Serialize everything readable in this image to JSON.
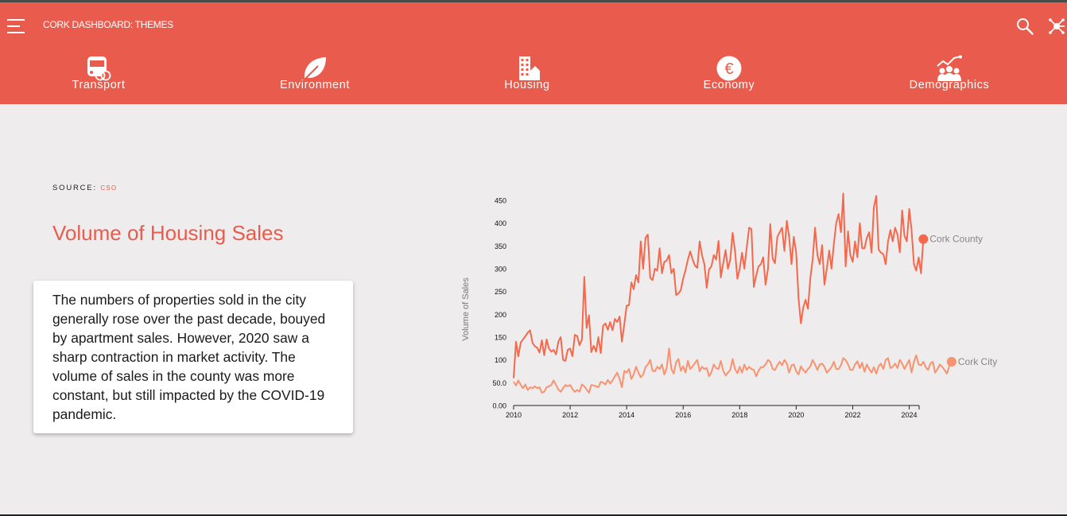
{
  "header": {
    "app_title": "CORK DASHBOARD: THEMES",
    "background": "#e95c4d",
    "nav": [
      {
        "label": "Transport",
        "icon": "bus-bike-icon"
      },
      {
        "label": "Environment",
        "icon": "leaf-icon"
      },
      {
        "label": "Housing",
        "icon": "building-icon"
      },
      {
        "label": "Economy",
        "icon": "euro-icon"
      },
      {
        "label": "Demographics",
        "icon": "people-chart-icon"
      }
    ]
  },
  "source": {
    "label": "SOURCE:",
    "link": "CSO"
  },
  "main": {
    "title": "Volume of Housing Sales",
    "description": "The numbers of properties sold in the city generally rose over the past decade, bouyed by apartment sales. However, 2020 saw a sharp contraction in market activity. The volume of sales in the county was more constant, but still impacted by the COVID-19 pandemic."
  },
  "chart_data": {
    "type": "line",
    "ylabel": "Volume of Sales",
    "xlabel": "",
    "xlim": [
      2010,
      2024.35
    ],
    "ylim": [
      0,
      450
    ],
    "x_ticks": [
      "2010",
      "2012",
      "2014",
      "2016",
      "2018",
      "2020",
      "2022",
      "2024"
    ],
    "y_ticks": [
      "0.00",
      "50.0",
      "100",
      "150",
      "200",
      "250",
      "300",
      "350",
      "400",
      "450"
    ],
    "grid": false,
    "x_step_months": 1,
    "x_start": 2010,
    "series": [
      {
        "name": "Cork County",
        "color": "#f4684c",
        "values": [
          60,
          140,
          108,
          138,
          145,
          152,
          160,
          165,
          138,
          130,
          127,
          116,
          143,
          110,
          145,
          125,
          118,
          122,
          112,
          140,
          150,
          100,
          98,
          122,
          125,
          108,
          155,
          152,
          132,
          145,
          282,
          170,
          198,
          117,
          131,
          118,
          150,
          115,
          175,
          180,
          166,
          183,
          165,
          190,
          183,
          195,
          140,
          178,
          219,
          220,
          270,
          255,
          286,
          270,
          360,
          300,
          368,
          375,
          280,
          275,
          300,
          296,
          345,
          290,
          315,
          318,
          330,
          290,
          300,
          242,
          246,
          253,
          278,
          297,
          320,
          338,
          321,
          307,
          302,
          360,
          330,
          310,
          258,
          299,
          305,
          330,
          320,
          361,
          281,
          312,
          341,
          300,
          320,
          379,
          340,
          278,
          300,
          335,
          300,
          347,
          390,
          387,
          260,
          285,
          305,
          310,
          325,
          265,
          300,
          398,
          322,
          312,
          370,
          380,
          390,
          339,
          405,
          370,
          310,
          370,
          335,
          234,
          180,
          215,
          232,
          212,
          280,
          320,
          390,
          330,
          310,
          352,
          265,
          300,
          340,
          300,
          355,
          400,
          420,
          380,
          465,
          305,
          382,
          330,
          315,
          360,
          325,
          400,
          345,
          345,
          368,
          380,
          335,
          435,
          460,
          342,
          335,
          332,
          310,
          360,
          385,
          360,
          390,
          375,
          336,
          428,
          372,
          360,
          431,
          385,
          310,
          296,
          325,
          290,
          365
        ]
      },
      {
        "name": "Cork City",
        "color": "#f8926f",
        "values": [
          52,
          44,
          55,
          45,
          38,
          46,
          34,
          40,
          38,
          42,
          38,
          40,
          28,
          30,
          40,
          42,
          45,
          55,
          45,
          35,
          30,
          38,
          45,
          42,
          45,
          36,
          30,
          34,
          30,
          46,
          42,
          35,
          28,
          45,
          44,
          42,
          40,
          52,
          50,
          46,
          56,
          48,
          55,
          64,
          72,
          58,
          40,
          76,
          72,
          80,
          58,
          68,
          85,
          72,
          62,
          68,
          84,
          90,
          100,
          76,
          75,
          85,
          80,
          90,
          68,
          82,
          125,
          80,
          70,
          95,
          102,
          76,
          86,
          72,
          98,
          80,
          86,
          93,
          100,
          75,
          85,
          80,
          82,
          64,
          73,
          90,
          82,
          80,
          98,
          76,
          66,
          72,
          78,
          102,
          80,
          71,
          85,
          72,
          90,
          78,
          85,
          80,
          78,
          64,
          76,
          84,
          84,
          90,
          100,
          96,
          80,
          78,
          88,
          96,
          88,
          100,
          92,
          72,
          88,
          90,
          75,
          68,
          86,
          78,
          72,
          80,
          86,
          100,
          90,
          78,
          90,
          92,
          85,
          72,
          78,
          84,
          96,
          80,
          80,
          88,
          104,
          100,
          90,
          78,
          78,
          90,
          97,
          82,
          94,
          74,
          90,
          80,
          72,
          84,
          70,
          86,
          92,
          80,
          100,
          104,
          82,
          85,
          92,
          82,
          100,
          92,
          80,
          90,
          100,
          72,
          96,
          110,
          90,
          88,
          96,
          84,
          78,
          92,
          96,
          72,
          80,
          90,
          85,
          78,
          70,
          86,
          96
        ]
      }
    ]
  }
}
